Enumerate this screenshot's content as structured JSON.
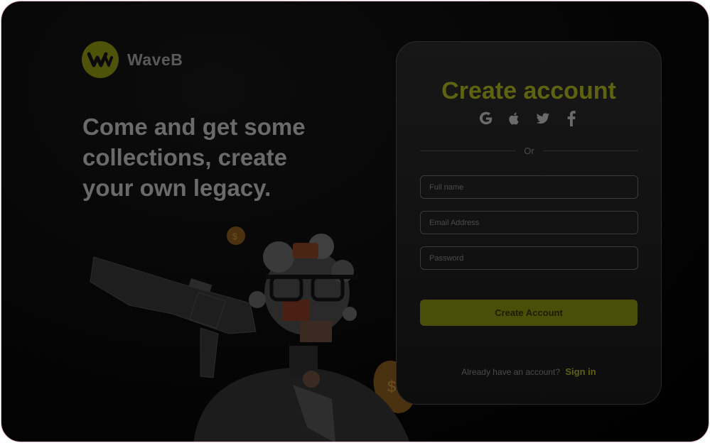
{
  "brand": {
    "name": "WaveB",
    "logo_icon": "wave-w-logo"
  },
  "hero": {
    "headline_line1": "Come and get some",
    "headline_line2": "collections, create",
    "headline_line3": "your own legacy.",
    "artwork_icon": "robot-character-with-gun"
  },
  "signup": {
    "title": "Create account",
    "social_icons": [
      "google-icon",
      "apple-icon",
      "twitter-icon",
      "facebook-icon"
    ],
    "divider_text": "Or",
    "full_name_placeholder": "Full name",
    "email_placeholder": "Email Address",
    "password_placeholder": "Password",
    "create_button_label": "Create Account",
    "signin_prompt": "Already have an account?",
    "signin_link": "Sign in"
  },
  "colors": {
    "accent": "#5e6311",
    "button": "#4b4e08",
    "background": "#050505"
  }
}
